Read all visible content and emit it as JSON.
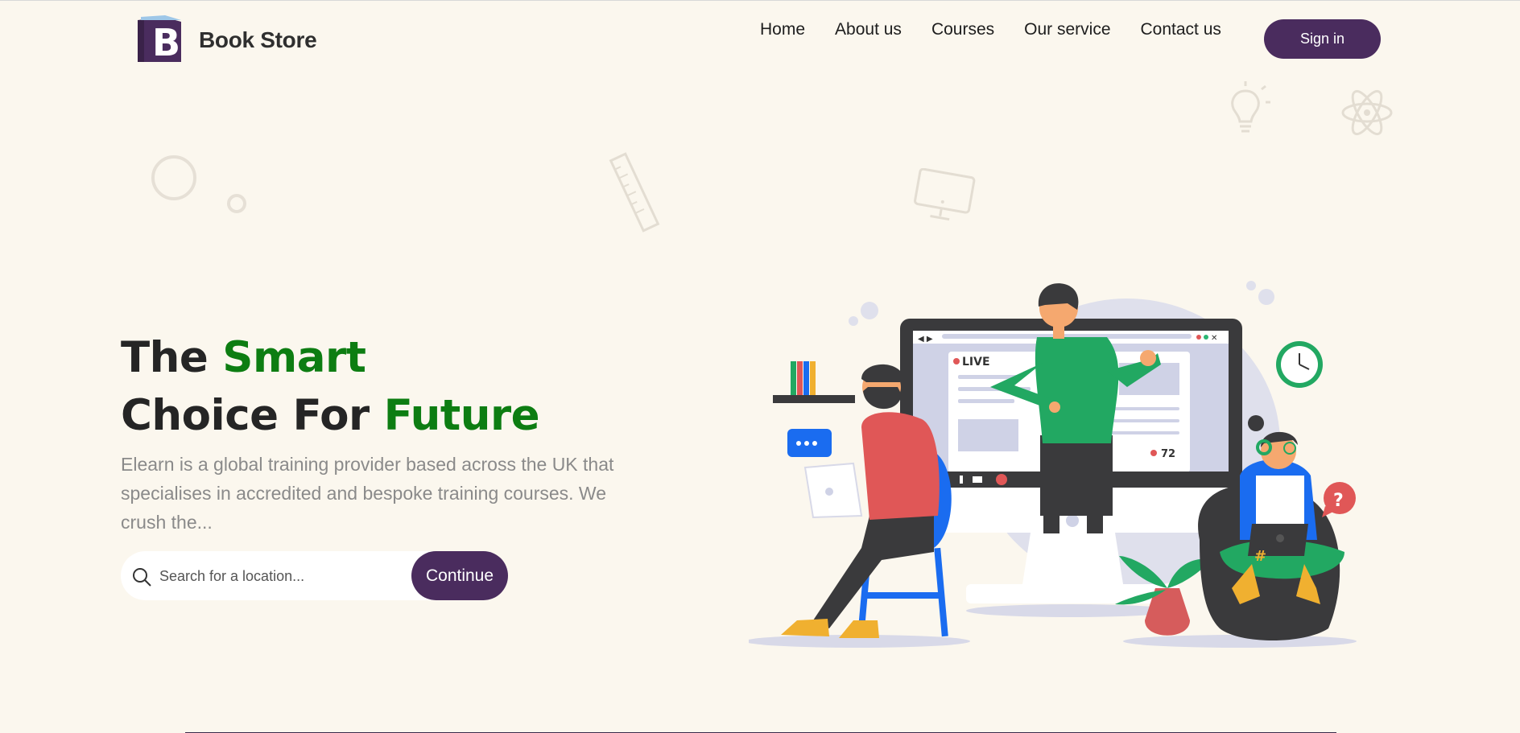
{
  "brand": {
    "name": "Book Store",
    "logo_letter": "B"
  },
  "nav": {
    "items": [
      "Home",
      "About us",
      "Courses",
      "Our service",
      "Contact us"
    ],
    "signin_label": "Sign in"
  },
  "hero": {
    "title_line1_plain": "The ",
    "title_line1_accent": "Smart",
    "title_line2_plain": "Choice For ",
    "title_line2_accent": "Future",
    "description": "Elearn is a global training provider based across the UK that specialises in accredited and bespoke training courses. We crush the...",
    "search_placeholder": "Search for a location...",
    "continue_label": "Continue"
  },
  "illustration": {
    "live_label": "LIVE",
    "viewer_count": "72",
    "hashtag": "#",
    "question_mark": "?"
  },
  "colors": {
    "background": "#fbf7ee",
    "brand_purple": "#4a2c5e",
    "accent_green": "#0d7d12"
  }
}
